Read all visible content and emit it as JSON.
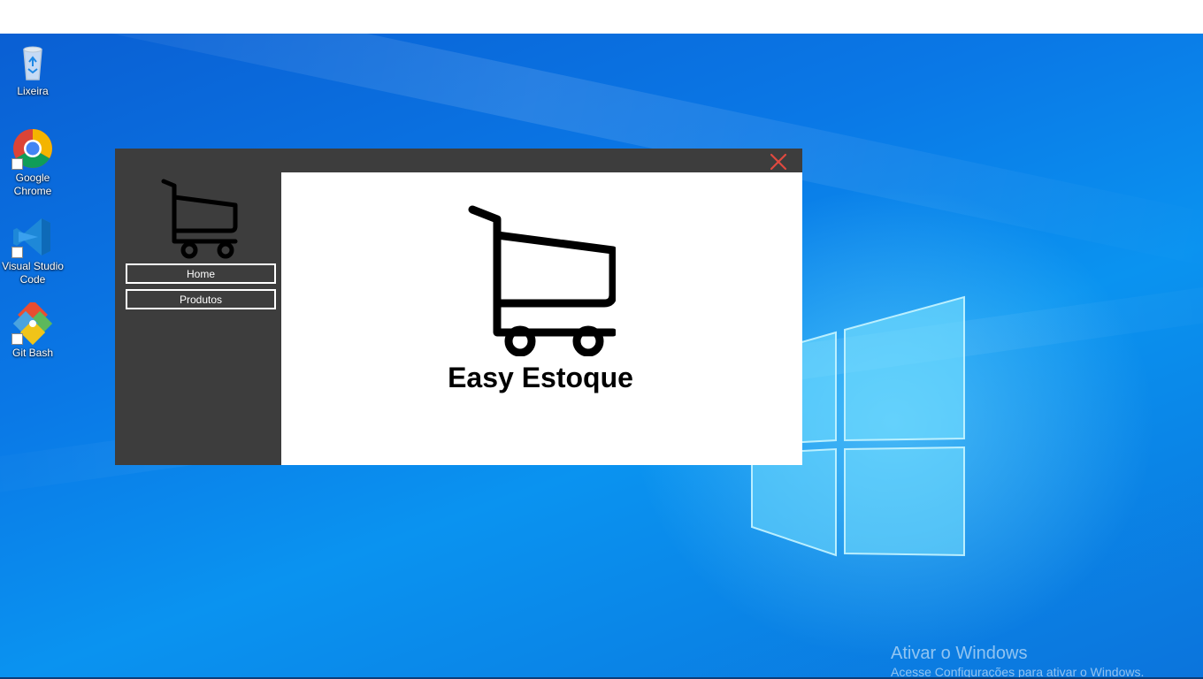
{
  "desktop": {
    "icons": [
      {
        "label": "Lixeira",
        "icon": "recycle-bin-icon"
      },
      {
        "label": "Google\nChrome",
        "icon": "chrome-icon"
      },
      {
        "label": "Visual Studio\nCode",
        "icon": "vscode-icon"
      },
      {
        "label": "Git Bash",
        "icon": "git-bash-icon"
      }
    ],
    "icon_labels": {
      "lixeira": "Lixeira",
      "chrome_line1": "Google",
      "chrome_line2": "Chrome",
      "vscode_line1": "Visual Studio",
      "vscode_line2": "Code",
      "gitbash": "Git Bash"
    },
    "activation": {
      "title": "Ativar o Windows",
      "subtitle": "Acesse Configurações para ativar o Windows."
    }
  },
  "app": {
    "title": "Easy Estoque",
    "nav": {
      "home_label": "Home",
      "produtos_label": "Produtos"
    },
    "icons": {
      "logo": "shopping-cart-icon",
      "close": "close-icon"
    },
    "colors": {
      "sidebar_bg": "#3d3d3d",
      "content_bg": "#ffffff",
      "close_color": "#e0493f"
    }
  }
}
